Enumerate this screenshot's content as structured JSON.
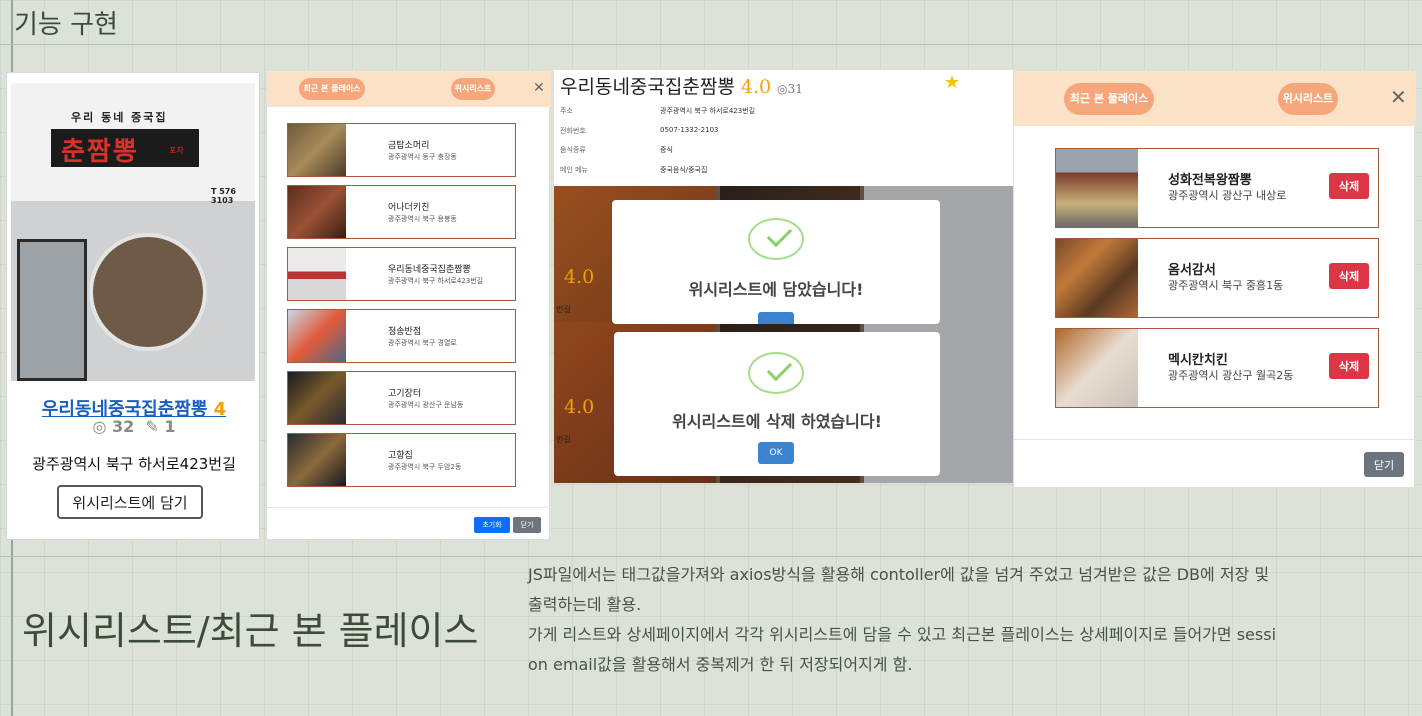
{
  "section_title": "기능 구현",
  "store_card": {
    "name": "우리동네중국집춘짬뽕",
    "rating": "4",
    "views": "32",
    "reviews": "1",
    "address": "광주광역시 북구 하서로423번길",
    "wishlist_button": "위시리스트에 담기",
    "sign_top": "우리 동네 중국집",
    "sign_main": "춘짬뽕",
    "sign_side": "포차",
    "sign_phone": "T 576 3103"
  },
  "wishlist_modal": {
    "tab_recent": "최근 본 플레이스",
    "tab_wishlist": "위시리스트",
    "items": [
      {
        "name": "금탑소머리",
        "address": "광주광역시 동구 충장동"
      },
      {
        "name": "어나더키친",
        "address": "광주광역시 북구 용봉동"
      },
      {
        "name": "우리동네중국집춘짬뽕",
        "address": "광주광역시 북구 하서로423번길"
      },
      {
        "name": "청송반점",
        "address": "광주광역시 북구 경열로"
      },
      {
        "name": "고기장터",
        "address": "광주광역시 광산구 운남동"
      },
      {
        "name": "고향집",
        "address": "광주광역시 북구 두암2동"
      }
    ],
    "reset_button": "초기화",
    "close_button": "닫기"
  },
  "detail": {
    "title": "우리동네중국집춘짬뽕",
    "rating": "4.0",
    "views": "31",
    "info": [
      {
        "label": "주소",
        "value": "광주광역시 북구 하서로423번길"
      },
      {
        "label": "전화번호",
        "value": "0507-1332-2103"
      },
      {
        "label": "음식종류",
        "value": "중식"
      },
      {
        "label": "메인 메뉴",
        "value": "중국음식/중국집"
      }
    ],
    "side_rating": "4.0",
    "side_text": "번길"
  },
  "alerts": {
    "added_message": "위시리스트에 담았습니다!",
    "deleted_message": "위시리스트에 삭제 하였습니다!",
    "ok_button": "OK"
  },
  "recent_modal": {
    "tab_recent": "최근 본 플레이스",
    "tab_wishlist": "위시리스트",
    "items": [
      {
        "name": "성화전복왕짬뽕",
        "address": "광주광역시 광산구 내상로"
      },
      {
        "name": "옴서감서",
        "address": "광주광역시 북구 중흥1동"
      },
      {
        "name": "멕시칸치킨",
        "address": "광주광역시 광산구 월곡2동"
      }
    ],
    "delete_button": "삭제",
    "close_button": "닫기"
  },
  "bottom": {
    "title": "위시리스트/최근 본 플레이스",
    "description": [
      "JS파일에서는 태그값을가져와 axios방식을 활용해 contoller에 값을 넘겨 주었고 넘겨받은 값은 DB에 저장 및",
      "출력하는데 활용.",
      "가게 리스트와 상세페이지에서 각각 위시리스트에 담을 수 있고 최근본 플레이스는 상세페이지로 들어가면 sessi",
      "on email값을 활용해서 중복제거 한 뒤 저장되어지게 함."
    ]
  },
  "colors": {
    "background": "#dde2d8",
    "modal_header": "#fbe2c6",
    "pill": "#f5a77b",
    "item_border": "#a5583a",
    "delete_red": "#dc3545",
    "link_blue": "#1a5fc0",
    "rating_orange": "#f2a100"
  }
}
